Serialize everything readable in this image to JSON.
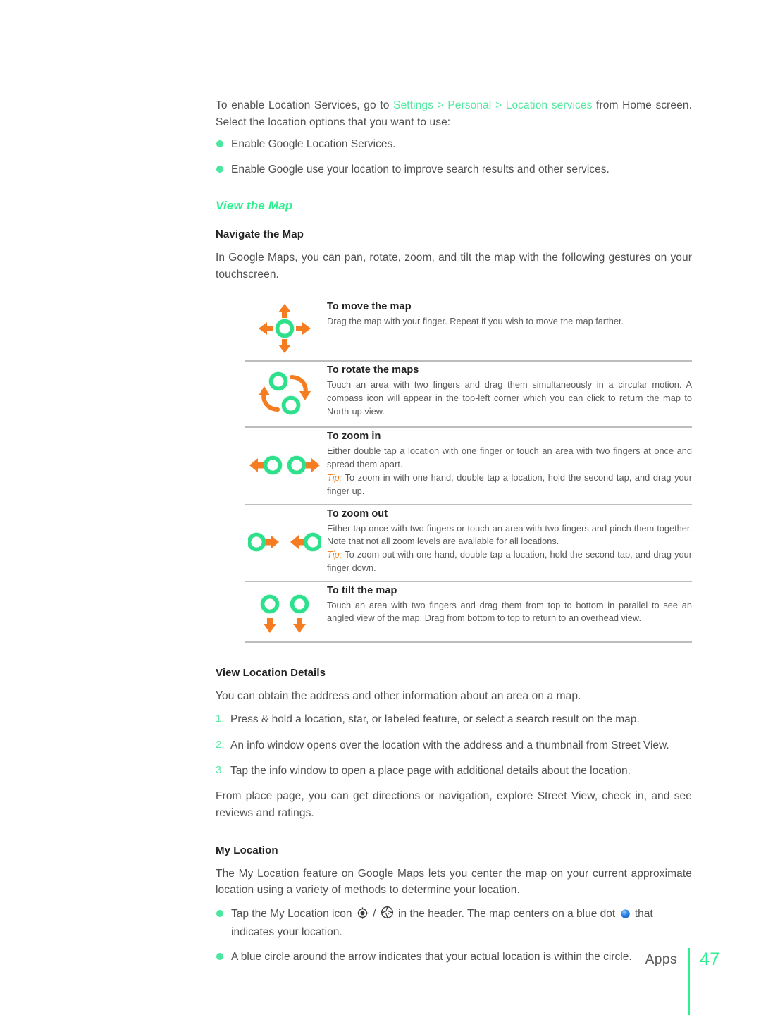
{
  "page": {
    "footer_label": "Apps",
    "page_number": "47",
    "accent_green": "#2df08f",
    "link_green": "#53e8a0",
    "bullet_green": "#4ce6a0",
    "accent_orange": "#f58220",
    "body_color": "#505050"
  },
  "intro": {
    "paragraph_before": "To enable Location Services, go to ",
    "path": "Settings > Personal > Location services",
    "paragraph_after": " from Home screen. Select the location options that you want to use:",
    "options": [
      "Enable Google Location Services.",
      "Enable Google use your location to improve search results and other services."
    ]
  },
  "view_the_map": {
    "title": "View the Map",
    "navigate": {
      "title": "Navigate the Map",
      "intro": "In Google Maps, you can pan, rotate, zoom, and tilt the map with the following gestures on your touchscreen."
    },
    "gestures": [
      {
        "icon": "move-map-icon",
        "title": "To move the map",
        "desc": "Drag the map with your finger. Repeat if you wish to move the map farther.",
        "tip_label": "",
        "tip": ""
      },
      {
        "icon": "rotate-map-icon",
        "title": "To rotate the maps",
        "desc": "Touch an area with two fingers and drag them simultaneously in a circular motion. A compass icon will appear in the top-left corner which you can click to return the map to North-up view.",
        "tip_label": "",
        "tip": ""
      },
      {
        "icon": "zoom-in-icon",
        "title": "To zoom in",
        "desc": "Either double tap a location with one finger or touch an area with two fingers at once and spread them apart.",
        "tip_label": "Tip:",
        "tip": " To zoom in with one hand, double tap a location, hold the second tap, and drag your finger up."
      },
      {
        "icon": "zoom-out-icon",
        "title": "To zoom out",
        "desc": "Either tap once with two fingers or touch an area with two fingers and pinch them together. Note that not all zoom levels are available for all locations.",
        "tip_label": "Tip:",
        "tip": " To zoom out with one hand, double tap a location, hold the second tap, and drag your finger down."
      },
      {
        "icon": "tilt-map-icon",
        "title": "To tilt the map",
        "desc": "Touch an area with two fingers and drag them from top to bottom in parallel to see an angled view of the map. Drag from bottom to top to return to an overhead view.",
        "tip_label": "",
        "tip": ""
      }
    ]
  },
  "view_location_details": {
    "title": "View Location Details",
    "intro": "You can obtain the address and other information about an area on a map.",
    "steps": [
      {
        "num": "1.",
        "text": "Press & hold a location, star, or labeled feature, or select a search result on the map."
      },
      {
        "num": "2.",
        "text": "An info window opens over the location with the address and a thumbnail from Street View."
      },
      {
        "num": "3.",
        "text": "Tap the info window to open a place page with additional details about the location."
      }
    ],
    "outro": "From place page, you can get directions or navigation, explore Street View, check in, and see reviews and ratings."
  },
  "my_location": {
    "title": "My Location",
    "intro": "The My Location feature on Google Maps lets you center the map on your current approximate location using a variety of methods to determine your location.",
    "bullet1_a": "Tap the My Location icon ",
    "bullet1_slash": " / ",
    "bullet1_b": " in the header. The map centers on a blue dot ",
    "bullet1_c": " that indicates your location.",
    "bullet2": "A blue circle around the arrow indicates that your actual location is within the circle."
  }
}
